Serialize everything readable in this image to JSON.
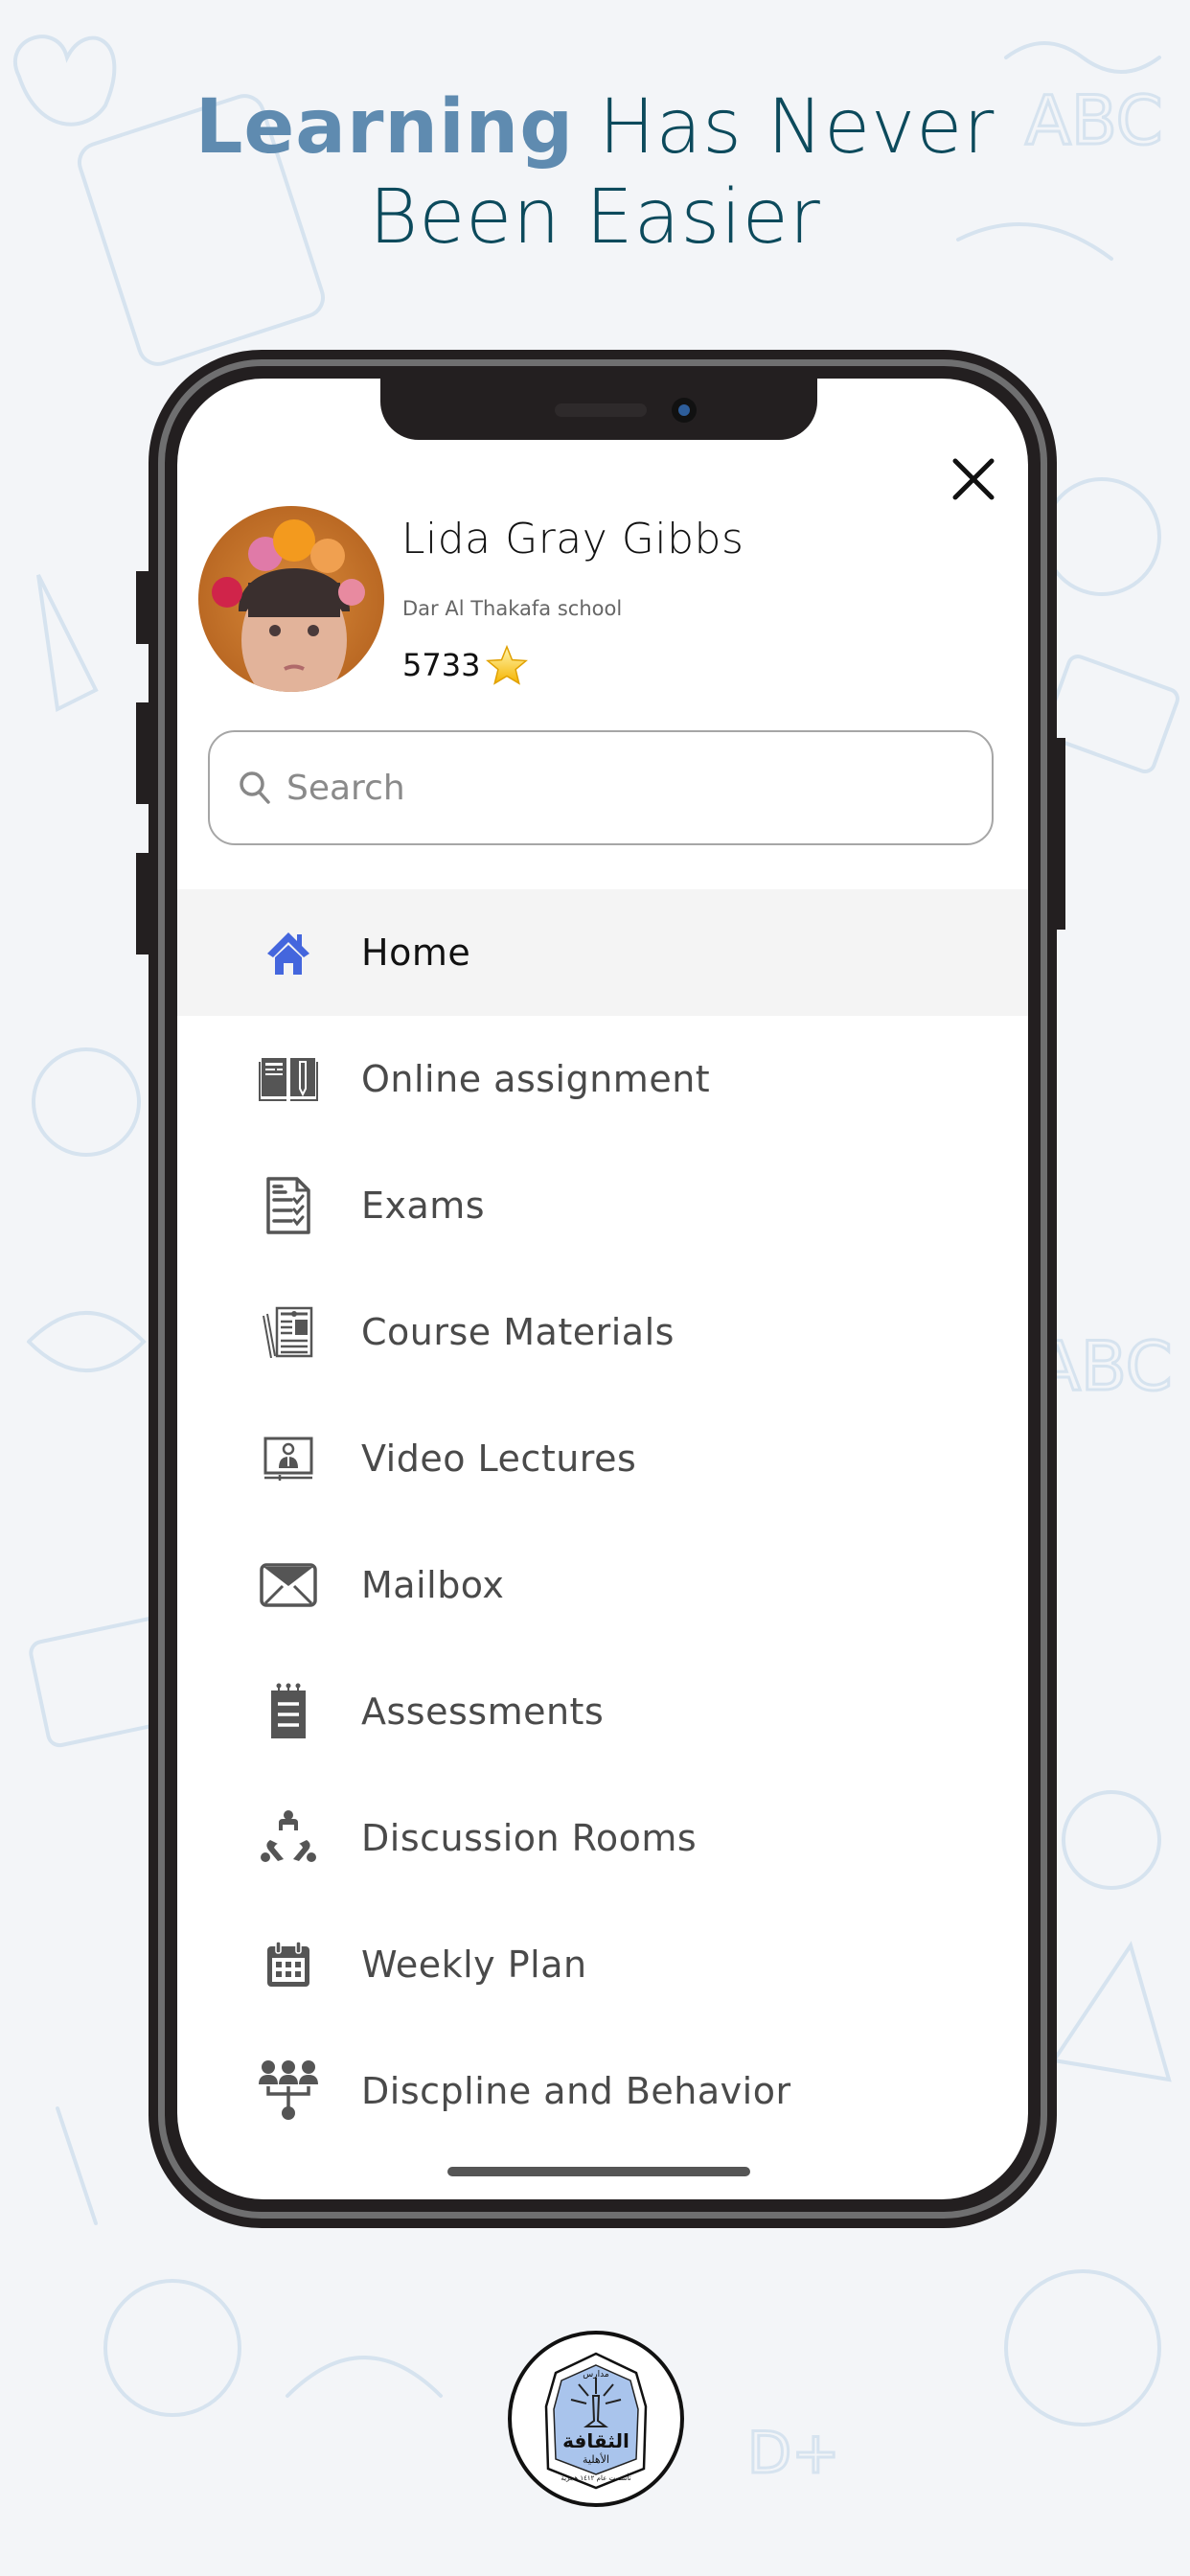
{
  "headline": {
    "accent": "Learning",
    "line1_rest": " Has Never",
    "line2": "Been Easier"
  },
  "colors": {
    "headline_accent": "#5f8bb0",
    "headline_text": "#0c4a5c",
    "home_icon": "#4466dd",
    "icon_gray": "#555555",
    "active_row_bg": "#f4f4f4"
  },
  "profile": {
    "name": "Lida Gray Gibbs",
    "school": "Dar Al Thakafa school",
    "points": "5733",
    "points_icon": "star-icon"
  },
  "search": {
    "placeholder": "Search",
    "value": ""
  },
  "menu": {
    "items": [
      {
        "label": "Home",
        "icon": "home-icon",
        "active": true
      },
      {
        "label": "Online assignment",
        "icon": "book-pencil-icon",
        "active": false
      },
      {
        "label": "Exams",
        "icon": "checklist-document-icon",
        "active": false
      },
      {
        "label": "Course Materials",
        "icon": "newspaper-icon",
        "active": false
      },
      {
        "label": "Video Lectures",
        "icon": "video-lecture-icon",
        "active": false
      },
      {
        "label": "Mailbox",
        "icon": "envelope-icon",
        "active": false
      },
      {
        "label": "Assessments",
        "icon": "notepad-icon",
        "active": false
      },
      {
        "label": "Discussion Rooms",
        "icon": "discussion-group-icon",
        "active": false
      },
      {
        "label": "Weekly Plan",
        "icon": "calendar-icon",
        "active": false
      },
      {
        "label": "Discpline and Behavior",
        "icon": "hierarchy-people-icon",
        "active": false
      }
    ]
  },
  "logo": {
    "title_arabic": "الثقافة",
    "subtitle_arabic": "الأهلية",
    "top_arabic": "مدارس",
    "bottom_arabic": "تأسست عام ١٤١٢ هجرية"
  }
}
